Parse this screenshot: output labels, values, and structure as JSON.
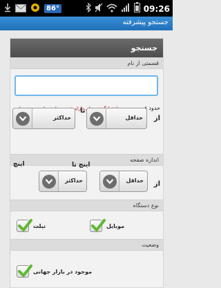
{
  "status_bar": {
    "temperature": "86°",
    "time": "09:26",
    "icons": [
      "download-icon",
      "mail-icon",
      "mail-icon",
      "bluetooth-icon",
      "mute-icon",
      "wifi-icon",
      "signal-icon",
      "battery-icon"
    ]
  },
  "action_bar": {
    "title": "جستجو پیشرفته"
  },
  "panel": {
    "header": "جستجو"
  },
  "name_section": {
    "label": "قسمتی از نام",
    "value": ""
  },
  "price_section": {
    "label": "حدود قیمت",
    "note": "(فقط گوشی های دارای قیمت نمایش داده می شوند)",
    "from": "از",
    "to": "تا",
    "min": "حداقل",
    "max": "حداکثر"
  },
  "screen_section": {
    "label": "اندازه صفحه",
    "from": "از",
    "inch1": "اینچ تا",
    "inch2": "اینچ",
    "min": "حداقل",
    "max": "حداکثر"
  },
  "device_section": {
    "label": "نوع دستگاه",
    "mobile": "موبایل",
    "tablet": "تبلت",
    "mobile_checked": true,
    "tablet_checked": true
  },
  "status_section": {
    "label": "وضعیت",
    "available": "موجود در بازار جهانی",
    "available_checked": true
  },
  "colors": {
    "accent": "#1f6fb8",
    "note": "#cc0000",
    "check": "#5fb832"
  }
}
